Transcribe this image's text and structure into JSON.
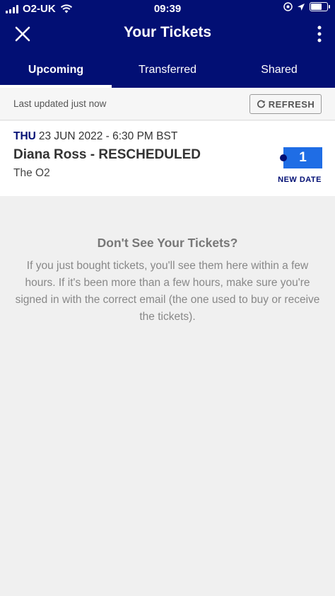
{
  "status_bar": {
    "carrier": "O2-UK",
    "time": "09:39",
    "battery_level": 0.7
  },
  "header": {
    "title": "Your Tickets",
    "close_icon": "close-icon",
    "more_icon": "more-vertical-icon"
  },
  "tabs": [
    {
      "label": "Upcoming",
      "active": true
    },
    {
      "label": "Transferred",
      "active": false
    },
    {
      "label": "Shared",
      "active": false
    }
  ],
  "update_bar": {
    "last_updated": "Last updated just now",
    "refresh_label": "REFRESH",
    "refresh_icon": "refresh-icon"
  },
  "event": {
    "day": "THU",
    "date_time": "23 JUN 2022 - 6:30 PM BST",
    "name": "Diana Ross - RESCHEDULED",
    "venue": "The O2",
    "ticket_count": "1",
    "status_label": "NEW DATE"
  },
  "empty_state": {
    "title": "Don't See Your Tickets?",
    "body": "If you just bought tickets, you'll see them here within a few hours. If it's been more than a few hours, make sure you're signed in with the correct email (the one used to buy or receive the tickets)."
  },
  "colors": {
    "header_bg": "#020f74",
    "accent": "#1f6de5",
    "page_bg": "#f0f0f0"
  }
}
